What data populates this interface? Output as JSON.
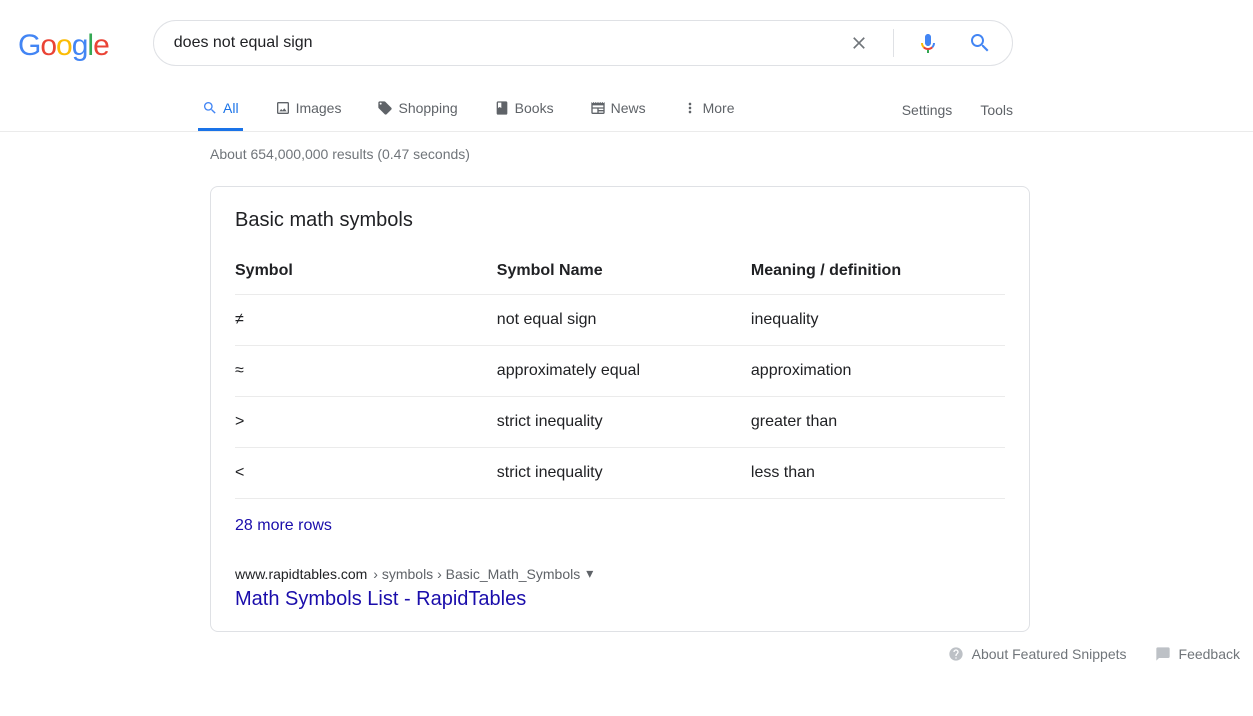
{
  "search": {
    "query": "does not equal sign"
  },
  "logo": [
    "G",
    "o",
    "o",
    "g",
    "l",
    "e"
  ],
  "tabs": {
    "all": "All",
    "images": "Images",
    "shopping": "Shopping",
    "books": "Books",
    "news": "News",
    "more": "More",
    "settings": "Settings",
    "tools": "Tools"
  },
  "stats": "About 654,000,000 results (0.47 seconds)",
  "snippet": {
    "heading": "Basic math symbols",
    "columns": [
      "Symbol",
      "Symbol Name",
      "Meaning / definition"
    ],
    "rows": [
      {
        "symbol": "≠",
        "name": "not equal sign",
        "meaning": "inequality"
      },
      {
        "symbol": "≈",
        "name": "approximately equal",
        "meaning": "approximation"
      },
      {
        "symbol": ">",
        "name": "strict inequality",
        "meaning": "greater than"
      },
      {
        "symbol": "<",
        "name": "strict inequality",
        "meaning": "less than"
      }
    ],
    "moreRows": "28 more rows",
    "cite": {
      "domain": "www.rapidtables.com",
      "path": " › symbols › Basic_Math_Symbols"
    },
    "title": "Math Symbols List - RapidTables"
  },
  "footer": {
    "about": "About Featured Snippets",
    "feedback": "Feedback"
  }
}
